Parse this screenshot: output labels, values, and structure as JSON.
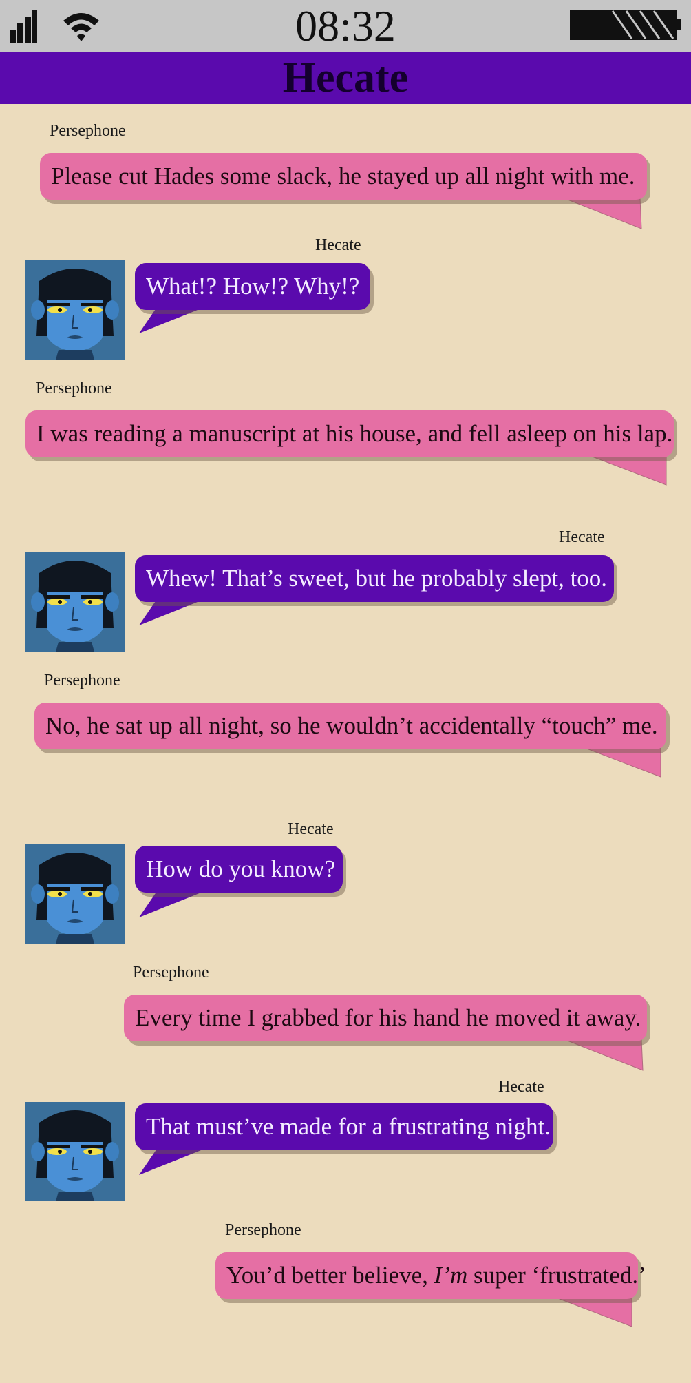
{
  "status_bar": {
    "time": "08:32",
    "icons": [
      "signal-icon",
      "wifi-icon",
      "battery-icon"
    ]
  },
  "header": {
    "title": "Hecate"
  },
  "colors": {
    "background": "#ecdcbd",
    "status_bar": "#c6c6c6",
    "header": "#5a0aad",
    "pink_bubble": "#e56fa4",
    "purple_bubble": "#5a0aad"
  },
  "messages": [
    {
      "sender": "Persephone",
      "text": "Please cut Hades some slack, he stayed up all night with me."
    },
    {
      "sender": "Hecate",
      "text": "What!? How!? Why!?"
    },
    {
      "sender": "Persephone",
      "text": "I was reading a manuscript at his house, and fell asleep on his lap."
    },
    {
      "sender": "Hecate",
      "text": "Whew! That’s sweet, but he probably slept, too."
    },
    {
      "sender": "Persephone",
      "text": "No, he sat up all night, so he wouldn’t accidentally “touch” me."
    },
    {
      "sender": "Hecate",
      "text": "How do you know?"
    },
    {
      "sender": "Persephone",
      "text": "Every time I grabbed for his hand he moved it away."
    },
    {
      "sender": "Hecate",
      "text": "That must’ve made for a frustrating night."
    },
    {
      "sender": "Persephone",
      "text_before": "You’d better believe, ",
      "text_emphasis": "I’m",
      "text_after": " super ‘frustrated.’"
    }
  ]
}
